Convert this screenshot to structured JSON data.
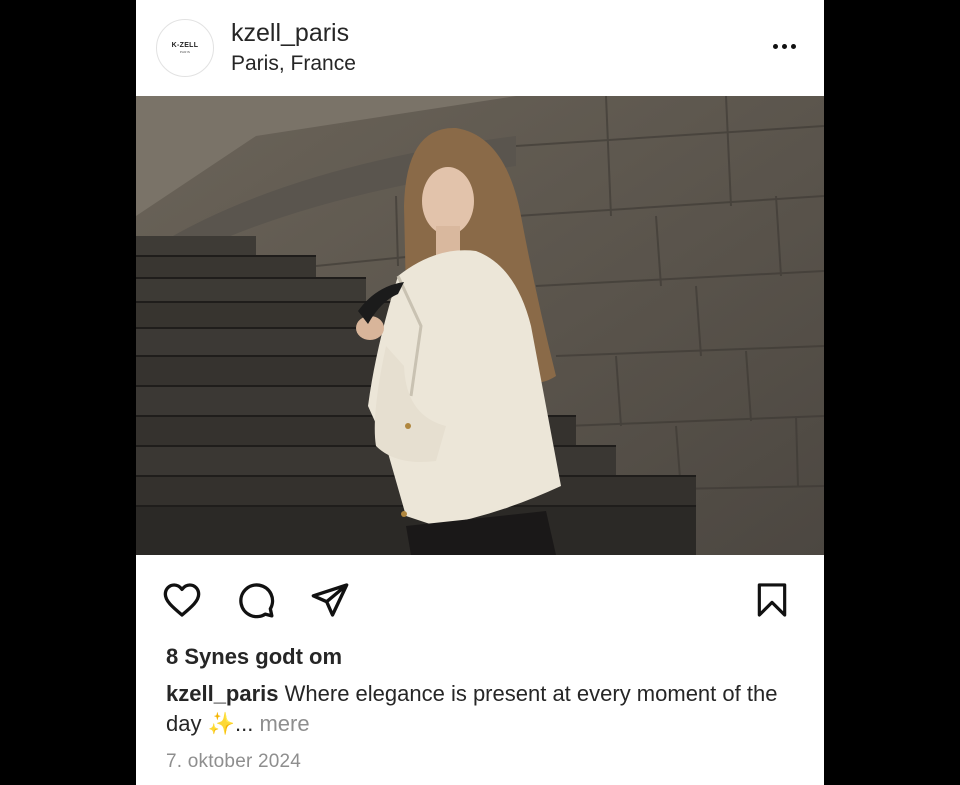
{
  "post": {
    "account": {
      "username": "kzell_paris",
      "location": "Paris, France",
      "avatar_logo": "K-ZELL",
      "avatar_logo_sub": "PARIS"
    },
    "more_icon": "more-horizontal-icon",
    "actions": {
      "like_icon": "heart-icon",
      "comment_icon": "comment-icon",
      "share_icon": "send-icon",
      "save_icon": "bookmark-icon"
    },
    "likes_text": "8 Synes godt om",
    "caption": {
      "username": "kzell_paris",
      "text": " Where elegance is present at every moment of the day ",
      "emoji": "✨",
      "ellipsis": "... ",
      "more_label": "mere"
    },
    "date": "7. oktober 2024"
  },
  "colors": {
    "background": "#000000",
    "card": "#ffffff",
    "text": "#262626",
    "muted": "#8e8e8e"
  }
}
